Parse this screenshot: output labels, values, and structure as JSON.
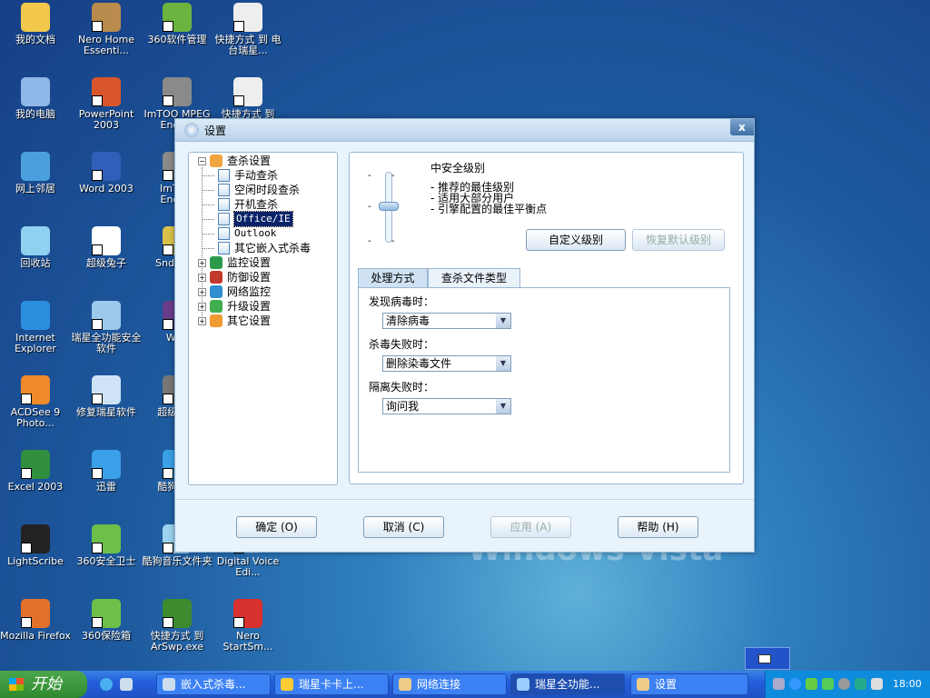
{
  "desktop": {
    "icons": [
      {
        "label": "我的文档",
        "color": "#f2c94c"
      },
      {
        "label": "Nero Home Essenti...",
        "color": "#b98b4c"
      },
      {
        "label": "360软件管理",
        "color": "#6cb33f"
      },
      {
        "label": "快捷方式 到 电台瑞星...",
        "color": "#eeeeee"
      },
      {
        "label": "我的电脑",
        "color": "#8fb8e8"
      },
      {
        "label": "PowerPoint 2003",
        "color": "#d9552b"
      },
      {
        "label": "ImTOO MPEG Enco...",
        "color": "#8a8a8a"
      },
      {
        "label": "快捷方式 到",
        "color": "#eeeeee"
      },
      {
        "label": "网上邻居",
        "color": "#4aa0dd"
      },
      {
        "label": "Word 2003",
        "color": "#2f5fb8"
      },
      {
        "label": "ImTOO Enco...",
        "color": "#8a8a8a"
      },
      {
        "label": "回收站",
        "color": "#8fd1f0"
      },
      {
        "label": "超级兔子",
        "color": "#ffffff"
      },
      {
        "label": "SndMa...",
        "color": "#d9c24a"
      },
      {
        "label": "Internet Explorer",
        "color": "#2b8fe0"
      },
      {
        "label": "瑞星全功能安全软件",
        "color": "#9cc9ec"
      },
      {
        "label": "Wi...",
        "color": "#6a3d8a"
      },
      {
        "label": "ACDSee 9 Photo...",
        "color": "#f08a2a"
      },
      {
        "label": "修复瑞星软件",
        "color": "#cfe3f6"
      },
      {
        "label": "超级解...",
        "color": "#777777"
      },
      {
        "label": "Excel 2003",
        "color": "#2f8f3f"
      },
      {
        "label": "迅雷",
        "color": "#3aa0e8"
      },
      {
        "label": "酷狗音...",
        "color": "#3aa0e8"
      },
      {
        "label": "LightScribe",
        "color": "#222222"
      },
      {
        "label": "360安全卫士",
        "color": "#6cc04a"
      },
      {
        "label": "酷狗音乐文件夹",
        "color": "#9cd4f0"
      },
      {
        "label": "Digital Voice Edi...",
        "color": "#5a8ac0"
      },
      {
        "label": "Mozilla Firefox",
        "color": "#e3702a"
      },
      {
        "label": "360保险箱",
        "color": "#6cc04a"
      },
      {
        "label": "快捷方式 到 ArSwp.exe",
        "color": "#3d8a2f"
      },
      {
        "label": "Nero StartSm...",
        "color": "#d93030"
      }
    ]
  },
  "dialog": {
    "title": "设置",
    "close": "x",
    "tree": {
      "root": "查杀设置",
      "children": [
        "手动查杀",
        "空闲时段查杀",
        "开机查杀",
        "Office/IE",
        "Outlook",
        "其它嵌入式杀毒"
      ],
      "others": [
        "监控设置",
        "防御设置",
        "网络监控",
        "升级设置",
        "其它设置"
      ]
    },
    "level": {
      "title": "中安全级别",
      "desc": [
        "- 推荐的最佳级别",
        "- 适用大部分用户",
        "- 引擎配置的最佳平衡点"
      ],
      "position": "middle",
      "custom_button": "自定义级别",
      "restore_button": "恢复默认级别"
    },
    "tabs": [
      "处理方式",
      "查杀文件类型"
    ],
    "fields": [
      {
        "label": "发现病毒时：",
        "value": "清除病毒"
      },
      {
        "label": "杀毒失败时：",
        "value": "删除染毒文件"
      },
      {
        "label": "隔离失败时：",
        "value": "询问我"
      }
    ],
    "buttons": {
      "ok": "确定 (O)",
      "cancel": "取消 (C)",
      "apply": "应用 (A)",
      "help": "帮助 (H)"
    }
  },
  "taskbar": {
    "start": "开始",
    "items": [
      "嵌入式杀毒...",
      "瑞星卡卡上...",
      "网络连接",
      "瑞星全功能...",
      "设置"
    ],
    "clock": "18:00"
  },
  "watermark": "Windows Vista"
}
